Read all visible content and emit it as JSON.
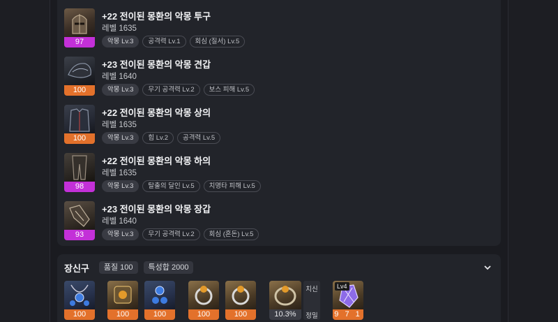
{
  "equipment": [
    {
      "name": "+22 전이된 몽환의 악몽 투구",
      "level": "레벨 1635",
      "quality": "97",
      "quality_color": "#c330d8",
      "icon": "helmet-icon",
      "tags": [
        "악몽 Lv.3",
        "공격력 Lv.1",
        "회심 (질서) Lv.5"
      ]
    },
    {
      "name": "+23 전이된 몽환의 악몽 견갑",
      "level": "레벨 1640",
      "quality": "100",
      "quality_color": "#e3712b",
      "icon": "shoulder-icon",
      "tags": [
        "악몽 Lv.3",
        "무기 공격력 Lv.2",
        "보스 피해 Lv.5"
      ]
    },
    {
      "name": "+22 전이된 몽환의 악몽 상의",
      "level": "레벨 1635",
      "quality": "100",
      "quality_color": "#e3712b",
      "icon": "chest-armor-icon",
      "tags": [
        "악몽 Lv.3",
        "힘 Lv.2",
        "공격력 Lv.5"
      ]
    },
    {
      "name": "+22 전이된 몽환의 악몽 하의",
      "level": "레벨 1635",
      "quality": "98",
      "quality_color": "#c330d8",
      "icon": "leg-armor-icon",
      "tags": [
        "악몽 Lv.3",
        "탈출의 달인 Lv.5",
        "치명타 피해 Lv.5"
      ]
    },
    {
      "name": "+23 전이된 몽환의 악몽 장갑",
      "level": "레벨 1640",
      "quality": "93",
      "quality_color": "#c330d8",
      "icon": "gloves-icon",
      "tags": [
        "악몽 Lv.3",
        "무기 공격력 Lv.2",
        "회심 (혼돈) Lv.5"
      ]
    }
  ],
  "accessories": {
    "title": "장신구",
    "quality_chip": "품질 100",
    "stat_chip": "특성합 2000",
    "items": [
      {
        "quality": "100",
        "icon": "necklace-icon"
      },
      {
        "quality": "100",
        "icon": "earring-icon"
      },
      {
        "quality": "100",
        "icon": "earring-icon"
      },
      {
        "quality": "100",
        "icon": "ring-icon"
      },
      {
        "quality": "100",
        "icon": "ring-icon"
      }
    ],
    "bracelet": {
      "value": "10.3%",
      "stat1": "치신",
      "stat2": "정밀",
      "icon": "bracelet-icon"
    },
    "ability_stone": {
      "level": "Lv4",
      "engraving": "9 7 1",
      "icon": "ability-stone-icon"
    }
  },
  "colors": {
    "accent_orange": "#e3712b",
    "accent_purple": "#c330d8"
  }
}
